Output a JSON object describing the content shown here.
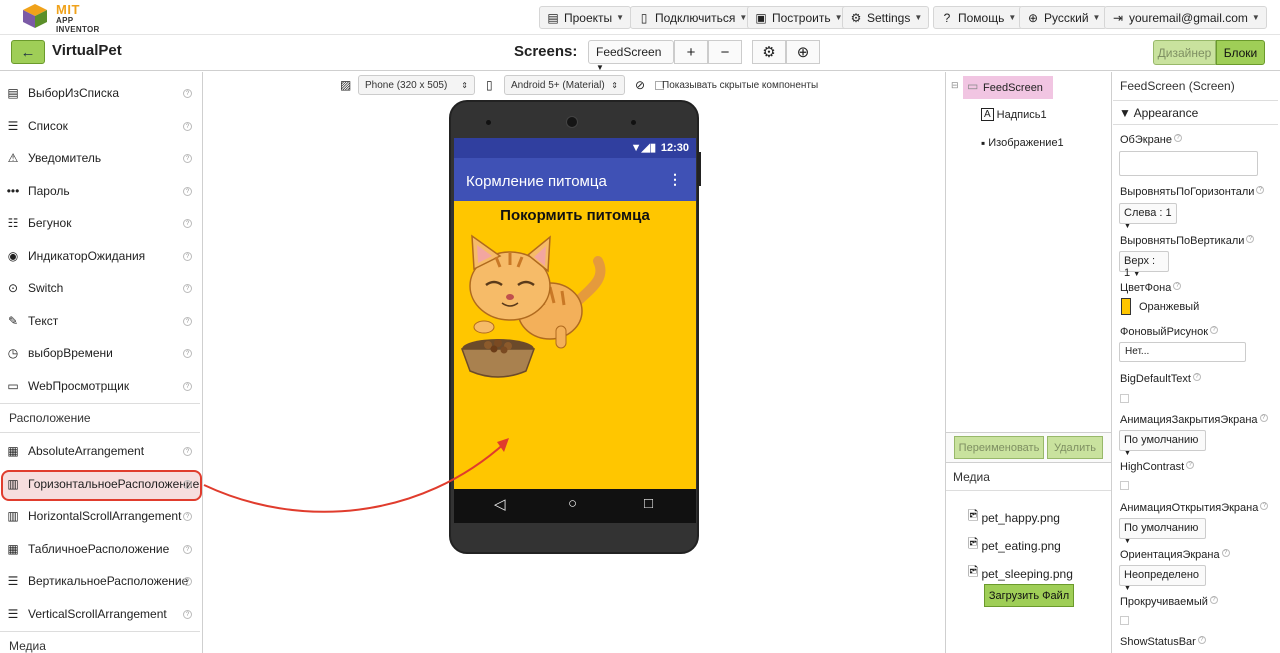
{
  "brand": {
    "line1": "MIT",
    "line2": "APP INVENTOR"
  },
  "topmenu": {
    "projects": "Проекты",
    "connect": "Подключиться",
    "build": "Построить",
    "settings": "Settings",
    "help": "Помощь",
    "language": "Русский",
    "account": "youremail@gmail.com"
  },
  "project": {
    "name": "VirtualPet",
    "screens_label": "Screens:",
    "screen_selected": "FeedScreen",
    "add": "+",
    "remove": "−",
    "designer": "Дизайнер",
    "blocks": "Блоки"
  },
  "palette": {
    "items": [
      {
        "label": "ВыборИзСписка",
        "icon": "list-picker-icon"
      },
      {
        "label": "Список",
        "icon": "list-view-icon"
      },
      {
        "label": "Уведомитель",
        "icon": "notifier-icon"
      },
      {
        "label": "Пароль",
        "icon": "password-icon"
      },
      {
        "label": "Бегунок",
        "icon": "slider-icon"
      },
      {
        "label": "ИндикаторОжидания",
        "icon": "spinner-icon"
      },
      {
        "label": "Switch",
        "icon": "switch-icon"
      },
      {
        "label": "Текст",
        "icon": "textbox-icon"
      },
      {
        "label": "выборВремени",
        "icon": "timepicker-icon"
      },
      {
        "label": "WebПросмотрщик",
        "icon": "webviewer-icon"
      }
    ],
    "section_layout": "Расположение",
    "layout_items": [
      {
        "label": "AbsoluteArrangement",
        "icon": "absolute-arrangement-icon"
      },
      {
        "label": "ГоризонтальноеРасположение",
        "icon": "horizontal-arrangement-icon"
      },
      {
        "label": "HorizontalScrollArrangement",
        "icon": "horizontal-scroll-icon"
      },
      {
        "label": "ТабличноеРасположение",
        "icon": "table-arrangement-icon"
      },
      {
        "label": "ВертикальноеРасположение",
        "icon": "vertical-arrangement-icon"
      },
      {
        "label": "VerticalScrollArrangement",
        "icon": "vertical-scroll-icon"
      }
    ],
    "section_media": "Медиа"
  },
  "viewer": {
    "device": "Phone (320 x 505)",
    "theme": "Android 5+ (Material)",
    "show_hidden": "Показывать скрытые компоненты",
    "status_time": "12:30",
    "app_title": "Кормление питомца",
    "label_text": "Покормить питомца"
  },
  "components": {
    "root": "FeedScreen",
    "children": [
      "Надпись1",
      "Изображение1"
    ],
    "rename": "Переименовать",
    "delete": "Удалить"
  },
  "media": {
    "title": "Медиа",
    "files": [
      "pet_happy.png",
      "pet_eating.png",
      "pet_sleeping.png"
    ],
    "upload": "Загрузить Файл"
  },
  "properties": {
    "title": "FeedScreen (Screen)",
    "group": "Appearance",
    "about": "ОбЭкране",
    "align_h": "ВыровнятьПоГоризонтали",
    "align_h_value": "Слева : 1",
    "align_v": "ВыровнятьПоВертикали",
    "align_v_value": "Верх : 1",
    "bg_color": "ЦветФона",
    "bg_color_value": "Оранжевый",
    "bg_image": "ФоновыйРисунок",
    "bg_image_value": "Нет...",
    "big_text": "BigDefaultText",
    "close_anim": "АнимацияЗакрытияЭкрана",
    "close_anim_value": "По умолчанию",
    "high_contrast": "HighContrast",
    "open_anim": "АнимацияОткрытияЭкрана",
    "open_anim_value": "По умолчанию",
    "orientation": "ОриентацияЭкрана",
    "orientation_value": "Неопределено",
    "scrollable": "Прокручиваемый",
    "show_status": "ShowStatusBar"
  },
  "colors": {
    "accent_green": "#9fce57",
    "screen_bg": "#ffc600",
    "appbar": "#3f51b5",
    "highlight": "#e03c2d"
  }
}
